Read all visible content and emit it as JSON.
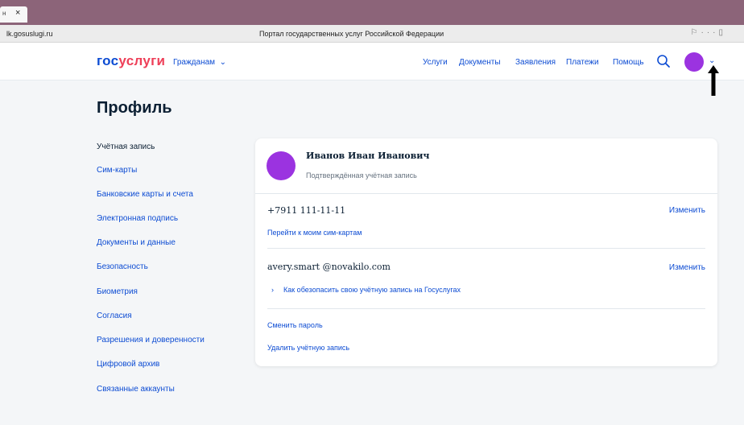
{
  "browser": {
    "tab_label": "н",
    "tab_close": "×",
    "url": "lk.gosuslugi.ru",
    "page_title": "Портал государственных услуг Российской Федерации"
  },
  "header": {
    "logo_part1": "гос",
    "logo_part2": "услуги",
    "audience_label": "Гражданам",
    "nav": [
      "Услуги",
      "Документы",
      "Заявления",
      "Платежи",
      "Помощь"
    ]
  },
  "page": {
    "title": "Профиль"
  },
  "sidebar": {
    "items": [
      "Учётная запись",
      "Сим-карты",
      "Банковские карты и счета",
      "Электронная подпись",
      "Документы и данные",
      "Безопасность",
      "Биометрия",
      "Согласия",
      "Разрешения и доверенности",
      "Цифровой архив",
      "Связанные аккаунты"
    ]
  },
  "profile": {
    "name": "Иванов Иван Иванович",
    "status": "Подтверждённая учётная запись",
    "phone": "+7911 111-11-11",
    "phone_edit": "Изменить",
    "sim_link": "Перейти к моим сим-картам",
    "email": "avery.smart  @novakilo.com",
    "email_edit": "Изменить",
    "security_tip": "Как обезопасить свою учётную запись на Госуслугах",
    "change_password": "Сменить пароль",
    "delete_account": "Удалить учётную запись"
  },
  "colors": {
    "brand_blue": "#0d4cd3",
    "brand_red": "#ee3f58",
    "avatar": "#9b33e0"
  }
}
